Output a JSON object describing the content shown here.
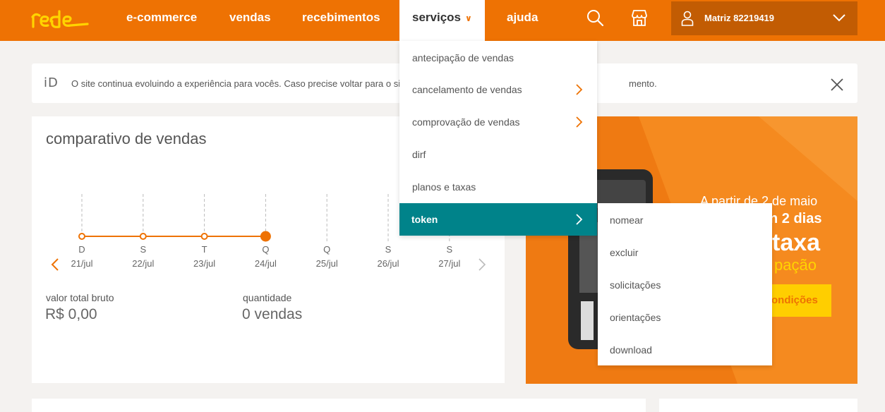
{
  "brand": {
    "logo_text": "rede",
    "accent": "#ee7203",
    "dark_accent": "#c25c03",
    "teal": "#00838a"
  },
  "nav": {
    "items": [
      "e-commerce",
      "vendas",
      "recebimentos",
      "serviços",
      "ajuda"
    ],
    "active": "serviços",
    "icons": [
      "search-icon",
      "store-icon"
    ],
    "account_label": "Matriz 82219419"
  },
  "notice": {
    "icon": "iD",
    "text": "O site continua evoluindo a experiência para vocês. Caso precise voltar para o site",
    "text_tail": "mento."
  },
  "card": {
    "title": "comparativo de vendas",
    "days": [
      {
        "letter": "D",
        "date": "21/jul"
      },
      {
        "letter": "S",
        "date": "22/jul"
      },
      {
        "letter": "T",
        "date": "23/jul"
      },
      {
        "letter": "Q",
        "date": "24/jul"
      },
      {
        "letter": "Q",
        "date": "25/jul"
      },
      {
        "letter": "S",
        "date": "26/jul"
      },
      {
        "letter": "S",
        "date": "27/jul"
      }
    ],
    "selected_day_index": 3,
    "total_label": "valor total bruto",
    "total_value": "R$ 0,00",
    "qty_label": "quantidade",
    "qty_value": "0 vendas"
  },
  "banner": {
    "line1": "A partir de 2 de maio",
    "line2": "n 2 dias",
    "line3": "taxa",
    "line4": "pação",
    "button": "ondições"
  },
  "dropdown": {
    "items": [
      {
        "label": "antecipação de vendas",
        "has_sub": false
      },
      {
        "label": "cancelamento de vendas",
        "has_sub": true
      },
      {
        "label": "comprovação de vendas",
        "has_sub": true
      },
      {
        "label": "dirf",
        "has_sub": false
      },
      {
        "label": "planos e taxas",
        "has_sub": false
      },
      {
        "label": "token",
        "has_sub": true
      }
    ],
    "active_index": 5
  },
  "submenu": {
    "items": [
      "nomear",
      "excluir",
      "solicitações",
      "orientações",
      "download"
    ]
  }
}
